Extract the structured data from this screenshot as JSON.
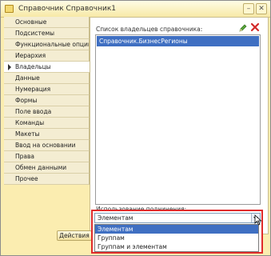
{
  "window": {
    "title": "Справочник Справочник1"
  },
  "sidebar": {
    "items": [
      {
        "label": "Основные",
        "active": false
      },
      {
        "label": "Подсистемы",
        "active": false
      },
      {
        "label": "Функциональные опции",
        "active": false
      },
      {
        "label": "Иерархия",
        "active": false
      },
      {
        "label": "Владельцы",
        "active": true
      },
      {
        "label": "Данные",
        "active": false
      },
      {
        "label": "Нумерация",
        "active": false
      },
      {
        "label": "Формы",
        "active": false
      },
      {
        "label": "Поле ввода",
        "active": false
      },
      {
        "label": "Команды",
        "active": false
      },
      {
        "label": "Макеты",
        "active": false
      },
      {
        "label": "Ввод на основании",
        "active": false
      },
      {
        "label": "Права",
        "active": false
      },
      {
        "label": "Обмен данными",
        "active": false
      },
      {
        "label": "Прочее",
        "active": false
      }
    ]
  },
  "owners": {
    "label": "Список владельцев справочника:",
    "items": [
      "Справочник.БизнесРегионы"
    ]
  },
  "usage": {
    "label": "Использование подчинения:",
    "value": "Элементам",
    "options": [
      "Элементам",
      "Группам",
      "Группам и элементам"
    ]
  },
  "actions": {
    "label": "Действия"
  },
  "colors": {
    "accent": "#e02b2b",
    "selection": "#3f6fc2",
    "window": "#fbedb0"
  }
}
